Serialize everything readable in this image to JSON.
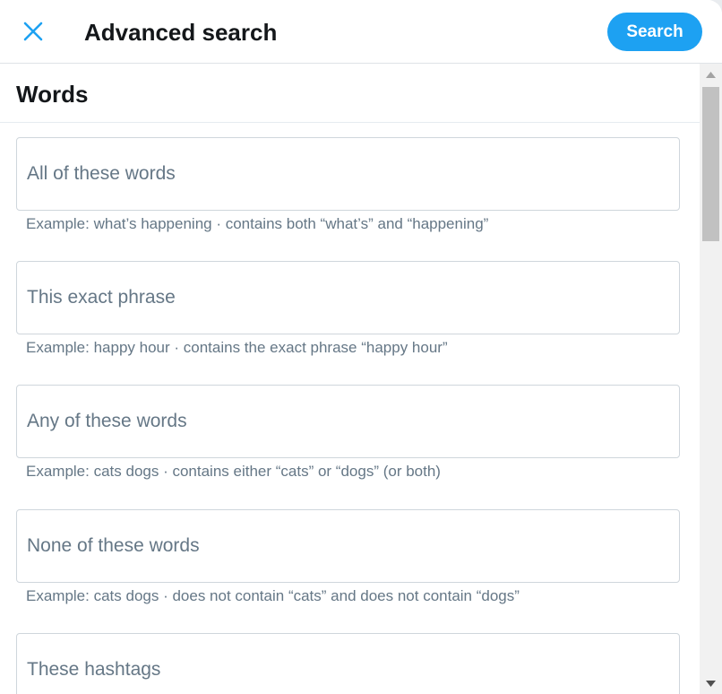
{
  "header": {
    "title": "Advanced search",
    "close_icon": "close-icon",
    "search_label": "Search"
  },
  "words_section": {
    "title": "Words",
    "fields": [
      {
        "placeholder": "All of these words",
        "value": "",
        "hint": "Example: what’s happening · contains both “what’s” and “happening”"
      },
      {
        "placeholder": "This exact phrase",
        "value": "",
        "hint": "Example: happy hour · contains the exact phrase “happy hour”"
      },
      {
        "placeholder": "Any of these words",
        "value": "",
        "hint": "Example: cats dogs · contains either “cats” or “dogs” (or both)"
      },
      {
        "placeholder": "None of these words",
        "value": "",
        "hint": "Example: cats dogs · does not contain “cats” and does not contain “dogs”"
      },
      {
        "placeholder": "These hashtags",
        "value": ""
      }
    ]
  },
  "colors": {
    "accent": "#1da1f2",
    "text_primary": "#14171a",
    "text_secondary": "#657786",
    "border": "#cfd6dc"
  }
}
